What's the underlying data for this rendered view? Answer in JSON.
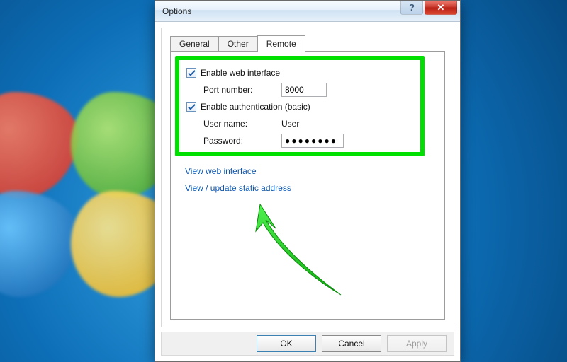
{
  "window": {
    "title": "Options",
    "help_symbol": "?",
    "close_symbol": "✕"
  },
  "tabs": {
    "general": "General",
    "other": "Other",
    "remote": "Remote",
    "active": "remote"
  },
  "remote": {
    "enable_web_label": "Enable web interface",
    "port_label": "Port number:",
    "port_value": "8000",
    "enable_auth_label": "Enable authentication (basic)",
    "username_label": "User name:",
    "username_value": "User",
    "password_label": "Password:",
    "password_value": "●●●●●●●●",
    "enable_web_checked": true,
    "enable_auth_checked": true,
    "link_view": "View web interface",
    "link_static": "View / update static address"
  },
  "buttons": {
    "ok": "OK",
    "cancel": "Cancel",
    "apply": "Apply",
    "apply_enabled": false
  },
  "annotation": {
    "highlight_color": "#00e000",
    "arrow_color": "#1fd61f"
  }
}
